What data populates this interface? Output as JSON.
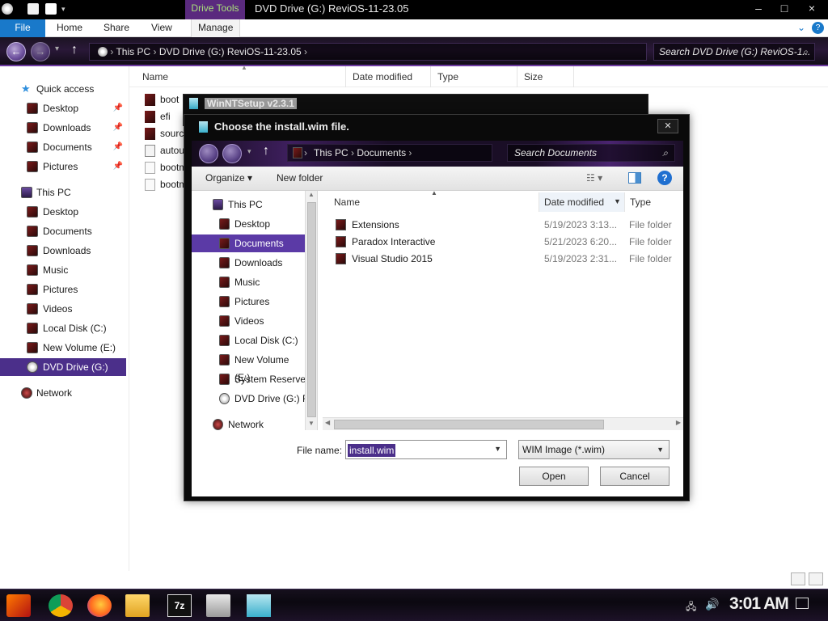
{
  "window": {
    "title": "DVD Drive (G:) ReviOS-11-23.05",
    "context_tab": "Drive Tools"
  },
  "ribbon": {
    "tabs": [
      "File",
      "Home",
      "Share",
      "View",
      "Manage"
    ],
    "help_icon": "help-icon"
  },
  "address": {
    "path": [
      "This PC",
      "DVD Drive (G:) ReviOS-11-23.05"
    ],
    "search_placeholder": "Search DVD Drive (G:) ReviOS-1..."
  },
  "sidebar": {
    "quick_access": "Quick access",
    "quick_items": [
      "Desktop",
      "Downloads",
      "Documents",
      "Pictures"
    ],
    "this_pc": "This PC",
    "pc_items": [
      "Desktop",
      "Documents",
      "Downloads",
      "Music",
      "Pictures",
      "Videos",
      "Local Disk (C:)",
      "New Volume (E:)",
      "DVD Drive (G:) Revi"
    ],
    "network": "Network"
  },
  "file_list": {
    "columns": [
      "Name",
      "Date modified",
      "Type",
      "Size"
    ],
    "rows": [
      "boot",
      "efi",
      "sourc",
      "autou",
      "bootm",
      "bootm"
    ]
  },
  "winntsetup": {
    "title": "WinNTSetup v2.3.1"
  },
  "dialog": {
    "title": "Choose the install.wim file.",
    "path": [
      "This PC",
      "Documents"
    ],
    "search_placeholder": "Search Documents",
    "toolbar": {
      "organize": "Organize",
      "new_folder": "New folder"
    },
    "nav_items": [
      "This PC",
      "Desktop",
      "Documents",
      "Downloads",
      "Music",
      "Pictures",
      "Videos",
      "Local Disk (C:)",
      "New Volume (E:)",
      "System Reserved",
      "DVD Drive (G:) R",
      "Network"
    ],
    "columns": [
      "Name",
      "Date modified",
      "Type"
    ],
    "files": [
      {
        "name": "Extensions",
        "date": "5/19/2023 3:13...",
        "type": "File folder"
      },
      {
        "name": "Paradox Interactive",
        "date": "5/21/2023 6:20...",
        "type": "File folder"
      },
      {
        "name": "Visual Studio 2015",
        "date": "5/19/2023 2:31...",
        "type": "File folder"
      }
    ],
    "file_name_label": "File name:",
    "file_name_value": "install.wim",
    "file_type": "WIM Image (*.wim)",
    "open_label": "Open",
    "cancel_label": "Cancel"
  },
  "taskbar": {
    "clock": "3:01 AM"
  },
  "colors": {
    "accent": "#5b3aa6",
    "file_tab": "#1979ca",
    "drive_tools_bg": "#5a2a7e",
    "drive_tools_text": "#a8e07a"
  }
}
